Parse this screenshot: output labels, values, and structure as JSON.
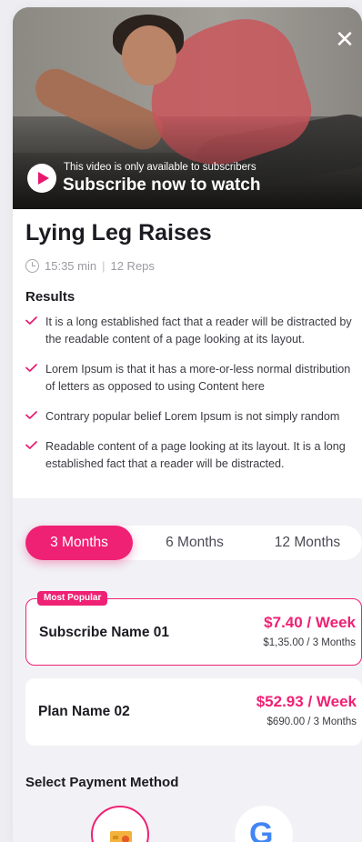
{
  "hero": {
    "subscriber_note": "This video is only available to subscribers",
    "subscribe_cta": "Subscribe now to watch",
    "close_glyph": "✕"
  },
  "workout": {
    "title": "Lying Leg Raises",
    "duration": "15:35 min",
    "reps": "12 Reps"
  },
  "results": {
    "heading": "Results",
    "items": [
      "It is a long established fact that a reader will be distracted by the readable content of a page looking at its layout.",
      "Lorem Ipsum is that it has a more-or-less normal distribution of letters as opposed to using Content here",
      "Contrary popular belief Lorem Ipsum is not simply random",
      "Readable content of a page looking at its layout. It is a long established fact that a reader will be distracted."
    ]
  },
  "tabs": [
    {
      "label": "3 Months",
      "active": true
    },
    {
      "label": "6 Months",
      "active": false
    },
    {
      "label": "12 Months",
      "active": false
    }
  ],
  "plans": [
    {
      "badge": "Most Popular",
      "name": "Subscribe Name 01",
      "price": "$7.40 / Week",
      "subtotal": "$1,35.00 / 3 Months",
      "selected": true
    },
    {
      "badge": "",
      "name": "Plan Name 02",
      "price": "$52.93 / Week",
      "subtotal": "$690.00 / 3 Months",
      "selected": false
    }
  ],
  "payment": {
    "heading": "Select Payment Method",
    "methods": [
      "card-icon",
      "google-icon"
    ],
    "google_glyph": "G"
  },
  "colors": {
    "accent": "#ef2174",
    "check": "#e8176d"
  }
}
